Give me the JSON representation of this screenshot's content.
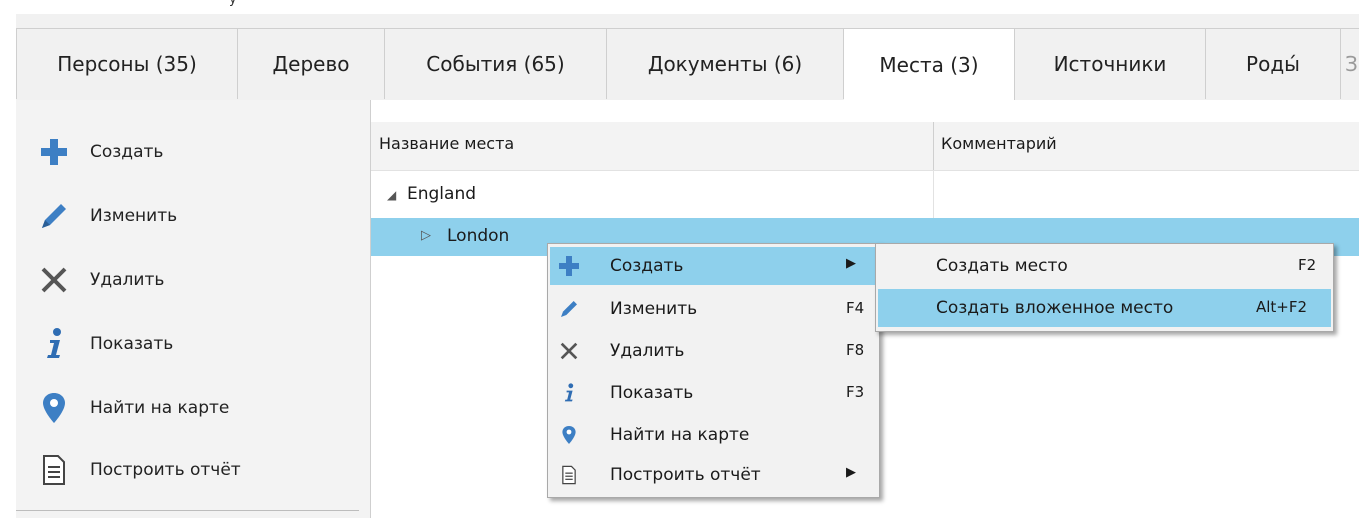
{
  "header": {
    "hint": "y"
  },
  "tabs": [
    {
      "label": "Персоны (35)"
    },
    {
      "label": "Дерево"
    },
    {
      "label": "События (65)"
    },
    {
      "label": "Документы (6)"
    },
    {
      "label": "Места (3)"
    },
    {
      "label": "Источники"
    },
    {
      "label": "Роды́"
    },
    {
      "label": "З"
    }
  ],
  "sidebar": {
    "items": [
      {
        "label": "Создать",
        "icon": "plus-icon"
      },
      {
        "label": "Изменить",
        "icon": "pencil-icon"
      },
      {
        "label": "Удалить",
        "icon": "close-icon"
      },
      {
        "label": "Показать",
        "icon": "info-icon"
      },
      {
        "label": "Найти на карте",
        "icon": "map-pin-icon"
      },
      {
        "label": "Построить отчёт",
        "icon": "report-icon"
      }
    ]
  },
  "grid": {
    "columns": [
      "Название места",
      "Комментарий"
    ],
    "rows": [
      {
        "expander": "◢",
        "name": "England"
      },
      {
        "expander": "▷",
        "name": "London"
      }
    ]
  },
  "context_menu": {
    "items": [
      {
        "label": "Создать",
        "shortcut": "",
        "arrow": "▶"
      },
      {
        "label": "Изменить",
        "shortcut": "F4",
        "arrow": ""
      },
      {
        "label": "Удалить",
        "shortcut": "F8",
        "arrow": ""
      },
      {
        "label": "Показать",
        "shortcut": "F3",
        "arrow": ""
      },
      {
        "label": "Найти на карте",
        "shortcut": "",
        "arrow": ""
      },
      {
        "label": "Построить отчёт",
        "shortcut": "",
        "arrow": "▶"
      }
    ]
  },
  "submenu": {
    "items": [
      {
        "label": "Создать место",
        "shortcut": "F2"
      },
      {
        "label": "Создать вложенное место",
        "shortcut": "Alt+F2"
      }
    ]
  },
  "colors": {
    "accent": "#3d7fc4",
    "selection": "#8ed0ec"
  }
}
